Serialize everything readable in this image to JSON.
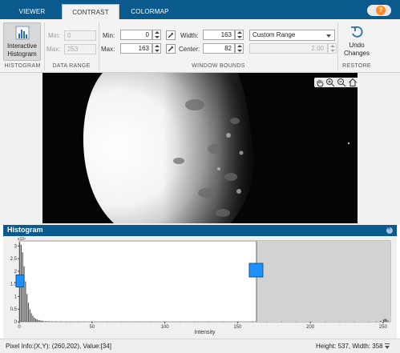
{
  "tabs": [
    {
      "label": "VIEWER",
      "active": false
    },
    {
      "label": "CONTRAST",
      "active": true
    },
    {
      "label": "COLORMAP",
      "active": false
    }
  ],
  "help_label": "?",
  "toolstrip": {
    "histogram_section": {
      "button_label_1": "Interactive",
      "button_label_2": "Histogram",
      "section_label": "HISTOGRAM"
    },
    "data_range": {
      "min_label": "Min:",
      "max_label": "Max:",
      "min_value": "0",
      "max_value": "253",
      "section_label": "DATA RANGE"
    },
    "window_bounds": {
      "min_label": "Min:",
      "max_label": "Max:",
      "min_value": "0",
      "max_value": "163",
      "width_label": "Width:",
      "center_label": "Center:",
      "width_value": "163",
      "center_value": "82",
      "range_mode": "Custom Range",
      "range_percent": "2.00",
      "section_label": "WINDOW BOUNDS"
    },
    "restore": {
      "button_label_1": "Undo",
      "button_label_2": "Changes",
      "section_label": "RESTORE"
    }
  },
  "histogram_panel": {
    "title": "Histogram",
    "close_icon": "close-icon"
  },
  "chart_data": {
    "type": "bar",
    "xlabel": "Intensity",
    "ylabel": "",
    "y_exponent": "x10⁴",
    "xlim": [
      0,
      255
    ],
    "ylim": [
      0,
      3.2
    ],
    "xticks": [
      0,
      50,
      100,
      150,
      200,
      250
    ],
    "yticks": [
      0,
      0.5,
      1,
      1.5,
      2,
      2.5,
      3
    ],
    "window": {
      "min": 0,
      "max": 163
    },
    "bins": [
      [
        0,
        3.15
      ],
      [
        1,
        3.05
      ],
      [
        2,
        2.75
      ],
      [
        3,
        2.2
      ],
      [
        4,
        1.6
      ],
      [
        5,
        1.1
      ],
      [
        6,
        0.75
      ],
      [
        7,
        0.5
      ],
      [
        8,
        0.34
      ],
      [
        9,
        0.24
      ],
      [
        10,
        0.17
      ],
      [
        11,
        0.12
      ],
      [
        12,
        0.09
      ],
      [
        13,
        0.07
      ],
      [
        14,
        0.055
      ],
      [
        15,
        0.045
      ],
      [
        16,
        0.038
      ],
      [
        18,
        0.03
      ],
      [
        20,
        0.025
      ],
      [
        22,
        0.02
      ],
      [
        25,
        0.016
      ],
      [
        28,
        0.013
      ],
      [
        32,
        0.011
      ],
      [
        36,
        0.01
      ],
      [
        40,
        0.009
      ],
      [
        50,
        0.007
      ],
      [
        60,
        0.006
      ],
      [
        70,
        0.006
      ],
      [
        80,
        0.005
      ],
      [
        90,
        0.005
      ],
      [
        100,
        0.005
      ],
      [
        110,
        0.005
      ],
      [
        120,
        0.005
      ],
      [
        130,
        0.005
      ],
      [
        140,
        0.006
      ],
      [
        150,
        0.006
      ],
      [
        160,
        0.007
      ],
      [
        170,
        0.007
      ],
      [
        180,
        0.008
      ],
      [
        190,
        0.008
      ],
      [
        200,
        0.008
      ],
      [
        210,
        0.008
      ],
      [
        220,
        0.009
      ],
      [
        230,
        0.009
      ],
      [
        240,
        0.01
      ],
      [
        245,
        0.015
      ],
      [
        248,
        0.04
      ],
      [
        250,
        0.09
      ],
      [
        251,
        0.13
      ],
      [
        252,
        0.1
      ],
      [
        253,
        0.05
      ]
    ]
  },
  "statusbar": {
    "pixel_info": "Pixel Info:(X,Y): (260,202), Value:[34]",
    "dims": "Height: 537, Width: 358"
  }
}
